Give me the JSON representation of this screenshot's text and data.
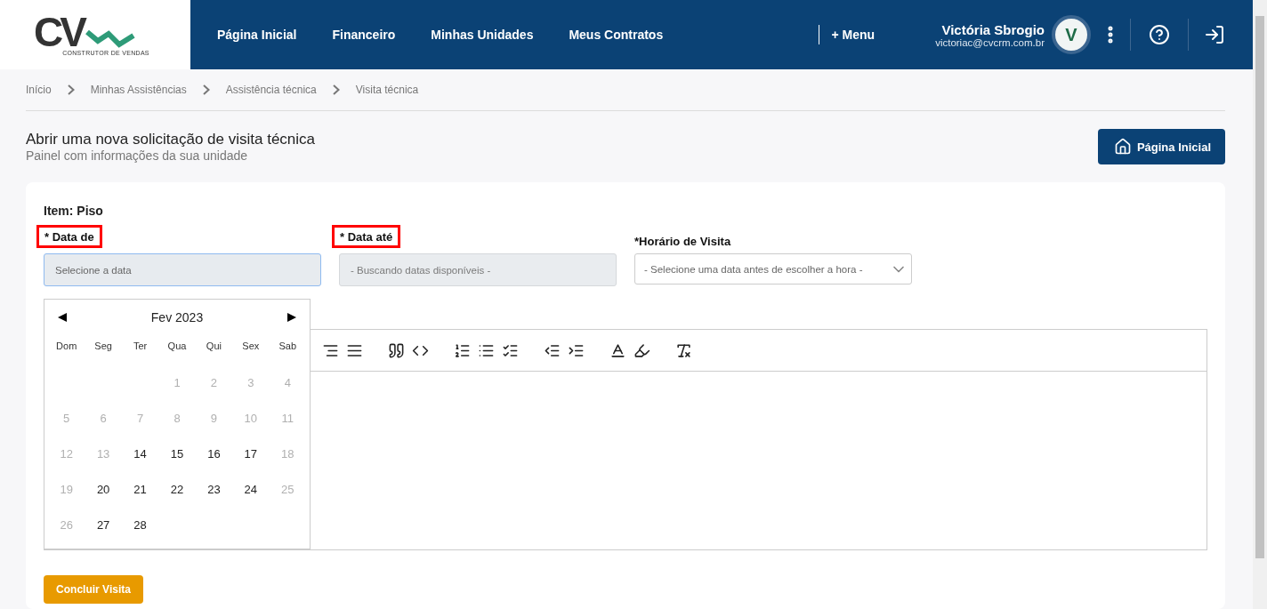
{
  "logo": {
    "mark": "CV",
    "tagline": "CONSTRUTOR DE VENDAS"
  },
  "nav": {
    "items": [
      {
        "label": "Página Inicial"
      },
      {
        "label": "Financeiro"
      },
      {
        "label": "Minhas Unidades"
      },
      {
        "label": "Meus Contratos"
      }
    ],
    "menu": "+ Menu"
  },
  "user": {
    "name": "Victória Sbrogio",
    "email": "victoriac@cvcrm.com.br",
    "avatar_letter": "V"
  },
  "breadcrumb": [
    "Início",
    "Minhas Assistências",
    "Assistência técnica",
    "Visita técnica"
  ],
  "page": {
    "title": "Abrir uma nova solicitação de visita técnica",
    "subtitle": "Painel com informações da sua unidade",
    "home_button": "Página Inicial"
  },
  "form": {
    "item": "Item: Piso",
    "fields": [
      {
        "label": "* Data de",
        "placeholder": "Selecione a data",
        "highlighted": true,
        "kind": "input",
        "disabled": false
      },
      {
        "label": "* Data até",
        "placeholder": "- Buscando datas disponíveis -",
        "highlighted": true,
        "kind": "input",
        "disabled": true
      },
      {
        "label": "*Horário de Visita",
        "placeholder": "- Selecione uma data antes de escolher a hora -",
        "highlighted": false,
        "kind": "select"
      }
    ],
    "submit": "Concluir Visita"
  },
  "calendar": {
    "month": "Fev 2023",
    "weekdays": [
      "Dom",
      "Seg",
      "Ter",
      "Qua",
      "Qui",
      "Sex",
      "Sab"
    ],
    "weeks": [
      {
        "days": [
          {
            "label": "1",
            "disabled": true
          },
          {
            "label": "2",
            "disabled": true
          },
          {
            "label": "3",
            "disabled": true
          },
          {
            "label": "4",
            "disabled": true
          }
        ]
      },
      {
        "days": [
          {
            "label": "5",
            "disabled": true
          },
          {
            "label": "6",
            "disabled": true
          },
          {
            "label": "7",
            "disabled": true
          },
          {
            "label": "8",
            "disabled": true
          },
          {
            "label": "9",
            "disabled": true
          },
          {
            "label": "10",
            "disabled": true
          },
          {
            "label": "11",
            "disabled": true
          }
        ]
      },
      {
        "days": [
          {
            "label": "12",
            "disabled": true
          },
          {
            "label": "13",
            "disabled": true
          },
          {
            "label": "14",
            "disabled": false
          },
          {
            "label": "15",
            "disabled": false
          },
          {
            "label": "16",
            "disabled": false
          },
          {
            "label": "17",
            "disabled": false
          },
          {
            "label": "18",
            "disabled": true
          }
        ]
      },
      {
        "days": [
          {
            "label": "19",
            "disabled": true
          },
          {
            "label": "20",
            "disabled": false
          },
          {
            "label": "21",
            "disabled": false
          },
          {
            "label": "22",
            "disabled": false
          },
          {
            "label": "23",
            "disabled": false
          },
          {
            "label": "24",
            "disabled": false
          },
          {
            "label": "25",
            "disabled": true
          }
        ]
      },
      {
        "days": [
          {
            "label": "26",
            "disabled": true
          },
          {
            "label": "27",
            "disabled": false
          },
          {
            "label": "28",
            "disabled": false
          }
        ]
      }
    ]
  }
}
